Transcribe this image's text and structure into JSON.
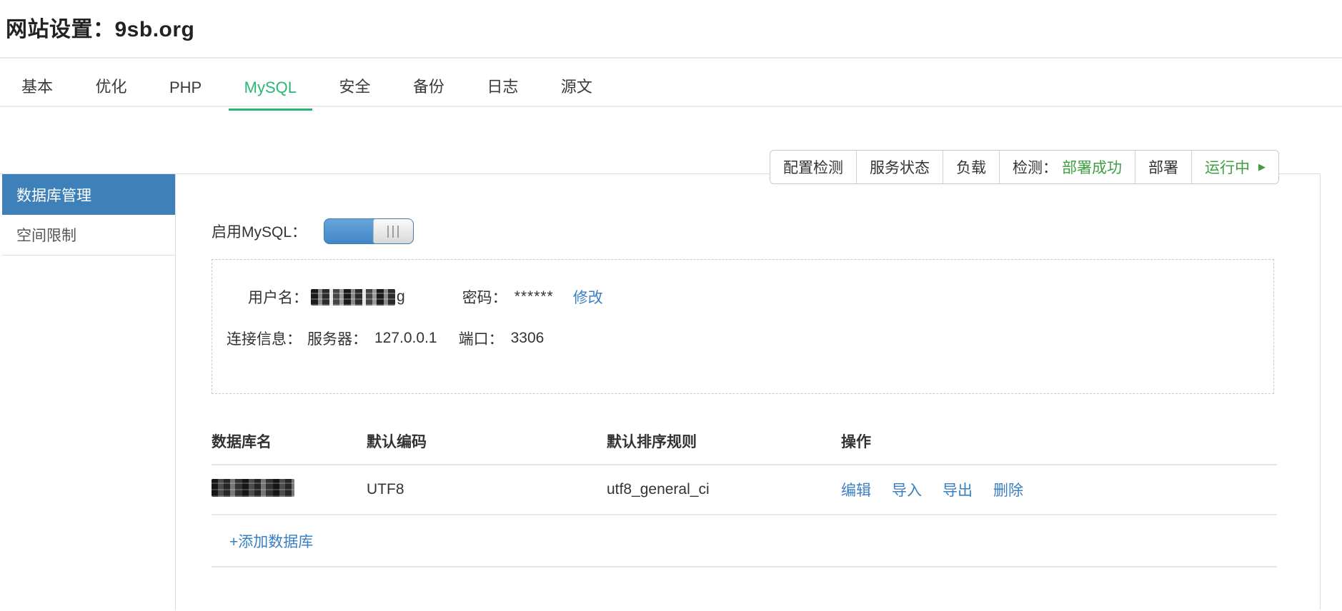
{
  "page": {
    "title": "网站设置：9sb.org"
  },
  "tabs": [
    {
      "label": "基本",
      "active": false
    },
    {
      "label": "优化",
      "active": false
    },
    {
      "label": "PHP",
      "active": false
    },
    {
      "label": "MySQL",
      "active": true
    },
    {
      "label": "安全",
      "active": false
    },
    {
      "label": "备份",
      "active": false
    },
    {
      "label": "日志",
      "active": false
    },
    {
      "label": "源文",
      "active": false
    }
  ],
  "toolbar": {
    "config_check": "配置检测",
    "service_status": "服务状态",
    "load": "负载",
    "detect_label": "检测：",
    "detect_status": "部署成功",
    "deploy": "部署",
    "running_label": "运行中",
    "running_icon": "▶"
  },
  "sidebar": {
    "items": [
      {
        "label": "数据库管理",
        "active": true
      },
      {
        "label": "空间限制",
        "active": false
      }
    ]
  },
  "mysql_panel": {
    "enable_label": "启用MySQL：",
    "toggle_state": "on",
    "account": {
      "username_label": "用户名：",
      "username_redacted": true,
      "username_visible_suffix": "g",
      "password_label": "密码：",
      "password_mask": "******",
      "modify_link": "修改"
    },
    "connection": {
      "label": "连接信息：",
      "server_label": "服务器：",
      "server_value": "127.0.0.1",
      "port_label": "端口：",
      "port_value": "3306"
    }
  },
  "database_table": {
    "headers": [
      "数据库名",
      "默认编码",
      "默认排序规则",
      "操作"
    ],
    "rows": [
      {
        "name_redacted": true,
        "encoding": "UTF8",
        "collation": "utf8_general_ci",
        "actions": [
          "编辑",
          "导入",
          "导出",
          "删除"
        ]
      }
    ],
    "add_link": "+添加数据库"
  },
  "colors": {
    "accent_green": "#2bb673",
    "status_green": "#3f9e3f",
    "link_blue": "#3a7fc1",
    "sidebar_active_bg": "#3e81ba",
    "toggle_blue": "#4286c5"
  }
}
